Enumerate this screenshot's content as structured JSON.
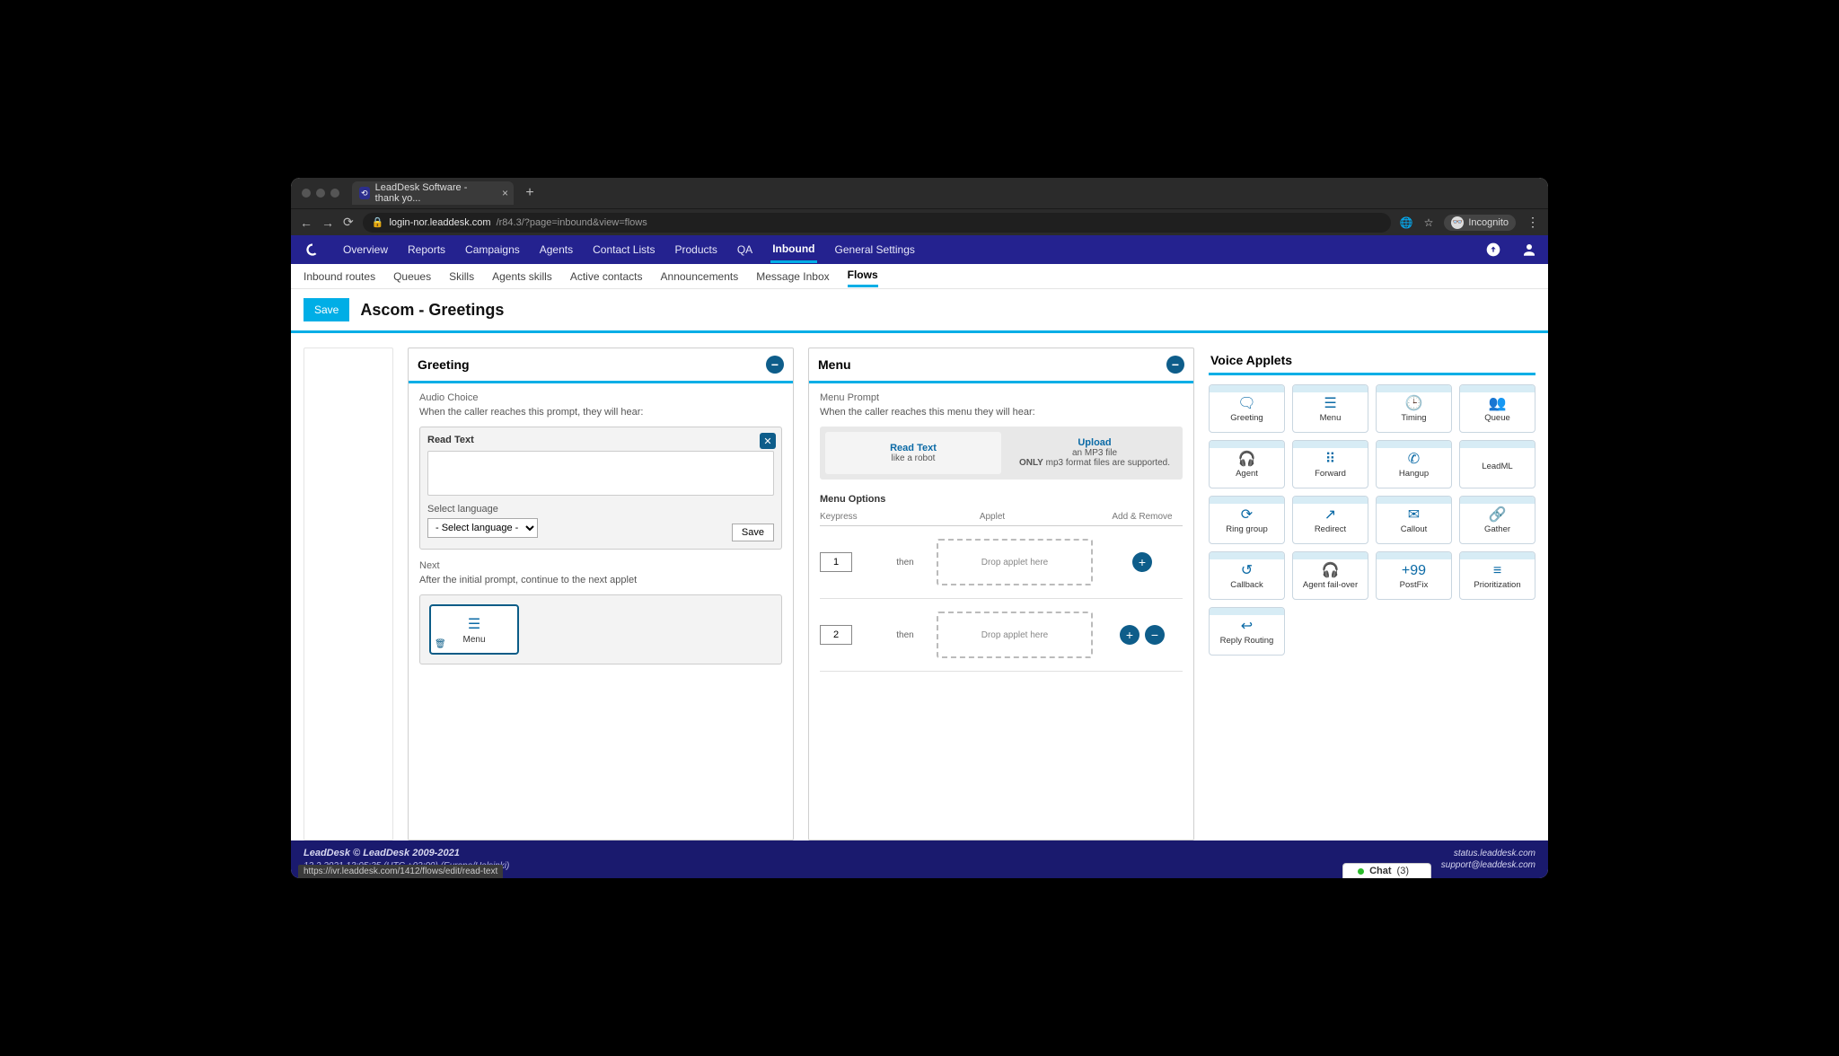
{
  "browser": {
    "tab_title": "LeadDesk Software - thank yo...",
    "url_host": "login-nor.leaddesk.com",
    "url_path": "/r84.3/?page=inbound&view=flows",
    "incognito": "Incognito"
  },
  "nav": {
    "items": [
      "Overview",
      "Reports",
      "Campaigns",
      "Agents",
      "Contact Lists",
      "Products",
      "QA",
      "Inbound",
      "General Settings"
    ],
    "active": "Inbound"
  },
  "subnav": {
    "items": [
      "Inbound routes",
      "Queues",
      "Skills",
      "Agents skills",
      "Active contacts",
      "Announcements",
      "Message Inbox",
      "Flows"
    ],
    "active": "Flows"
  },
  "title_bar": {
    "save": "Save",
    "title": "Ascom - Greetings"
  },
  "greeting": {
    "title": "Greeting",
    "audio_choice": "Audio Choice",
    "audio_desc": "When the caller reaches this prompt, they will hear:",
    "read_text_label": "Read Text",
    "textarea_value": "",
    "select_language_label": "Select language",
    "select_language_option": "- Select language -",
    "save_small": "Save",
    "next_label": "Next",
    "next_desc": "After the initial prompt, continue to the next applet",
    "next_applet_label": "Menu"
  },
  "menu": {
    "title": "Menu",
    "prompt_label": "Menu Prompt",
    "prompt_desc": "When the caller reaches this menu they will hear:",
    "read_text": "Read Text",
    "read_sub": "like a robot",
    "upload": "Upload",
    "upload_sub1": "an MP3 file",
    "upload_sub2_bold": "ONLY",
    "upload_sub2_rest": " mp3 format files are supported.",
    "options_label": "Menu Options",
    "columns": {
      "key": "Keypress",
      "applet": "Applet",
      "act": "Add & Remove"
    },
    "then": "then",
    "drop": "Drop applet here",
    "rows": [
      {
        "key": "1",
        "show_remove": false
      },
      {
        "key": "2",
        "show_remove": true
      }
    ]
  },
  "applets": {
    "title": "Voice Applets",
    "items": [
      {
        "name": "Greeting",
        "icon": "🗨"
      },
      {
        "name": "Menu",
        "icon": "☰"
      },
      {
        "name": "Timing",
        "icon": "🕒"
      },
      {
        "name": "Queue",
        "icon": "👥"
      },
      {
        "name": "Agent",
        "icon": "🎧"
      },
      {
        "name": "Forward",
        "icon": "⠿"
      },
      {
        "name": "Hangup",
        "icon": "✆"
      },
      {
        "name": "LeadML",
        "icon": "</>"
      },
      {
        "name": "Ring group",
        "icon": "⟳"
      },
      {
        "name": "Redirect",
        "icon": "↗"
      },
      {
        "name": "Callout",
        "icon": "✉"
      },
      {
        "name": "Gather",
        "icon": "🔗"
      },
      {
        "name": "Callback",
        "icon": "↺"
      },
      {
        "name": "Agent fail-over",
        "icon": "🎧"
      },
      {
        "name": "PostFix",
        "icon": "+99"
      },
      {
        "name": "Prioritization",
        "icon": "≡"
      },
      {
        "name": "Reply Routing",
        "icon": "↩"
      }
    ]
  },
  "footer": {
    "copyright": "LeadDesk © LeadDesk 2009-2021",
    "timestamp": "12.2.2021 13:05:35 (UTC +02:00) (Europe/Helsinki)",
    "status_url": "https://ivr.leaddesk.com/1412/flows/edit/read-text",
    "status": "status.leaddesk.com",
    "support": "support@leaddesk.com",
    "chat_label": "Chat",
    "chat_count": "3"
  }
}
